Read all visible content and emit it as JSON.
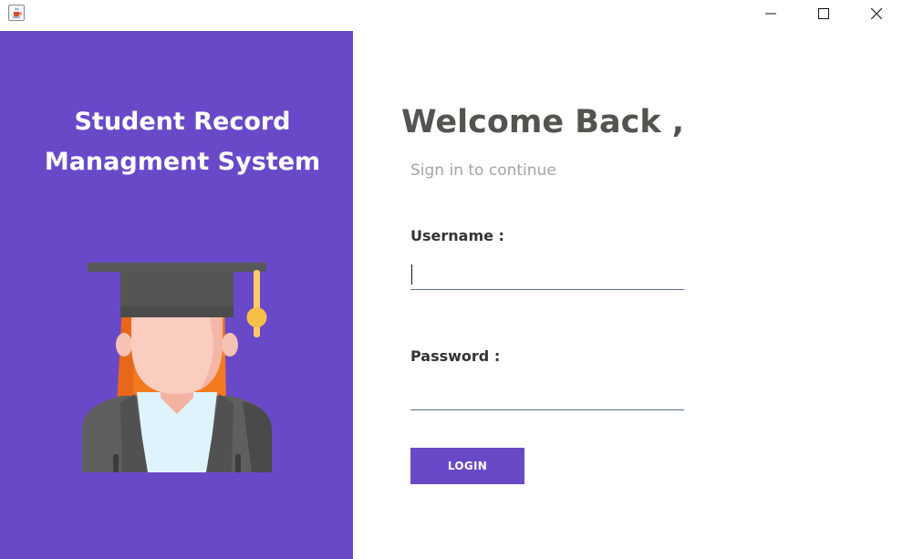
{
  "window": {
    "app_icon": "java-coffee-cup-icon",
    "controls": [
      "minimize-icon",
      "maximize-icon",
      "close-icon"
    ]
  },
  "left_panel": {
    "background": "#6a49c9",
    "title_line1": "Student Record",
    "title_line2": "Managment System",
    "illustration": "graduate-student-icon"
  },
  "login_form": {
    "heading": "Welcome Back ,",
    "subtitle": "Sign in to continue",
    "username_label": "Username :",
    "username_value": "",
    "password_label": "Password :",
    "password_value": "",
    "login_button_label": "LOGIN",
    "accent_color": "#6a49c9"
  }
}
